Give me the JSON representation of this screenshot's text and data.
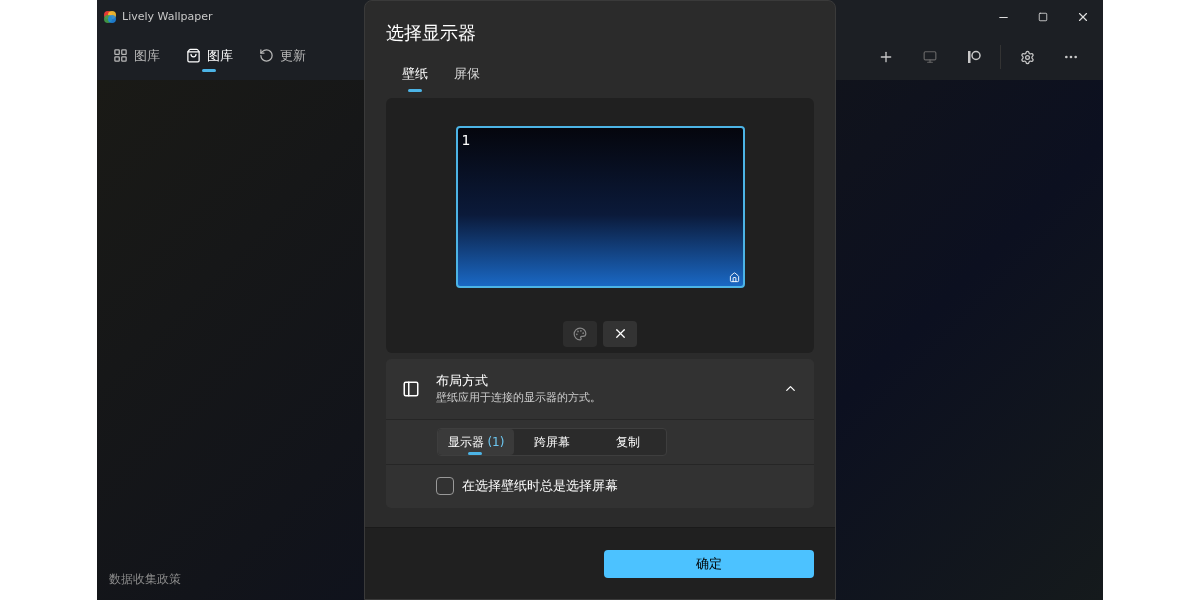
{
  "window": {
    "title": "Lively Wallpaper"
  },
  "nav": [
    {
      "label": "图库",
      "selected": false
    },
    {
      "label": "图库",
      "selected": true
    },
    {
      "label": "更新",
      "selected": false
    }
  ],
  "footer_link": "数据收集政策",
  "dialog": {
    "title": "选择显示器",
    "tabs": [
      {
        "label": "壁纸",
        "selected": true
      },
      {
        "label": "屏保",
        "selected": false
      }
    ],
    "monitors": [
      {
        "label": "1",
        "selected": true
      }
    ],
    "layout": {
      "title": "布局方式",
      "description": "壁纸应用于连接的显示器的方式。",
      "expanded": true,
      "options": [
        {
          "label": "显示器",
          "count": "(1)",
          "selected": true
        },
        {
          "label": "跨屏幕",
          "selected": false
        },
        {
          "label": "复制",
          "selected": false
        }
      ]
    },
    "always_choose": {
      "label": "在选择壁纸时总是选择屏幕",
      "checked": false
    },
    "confirm": "确定"
  }
}
